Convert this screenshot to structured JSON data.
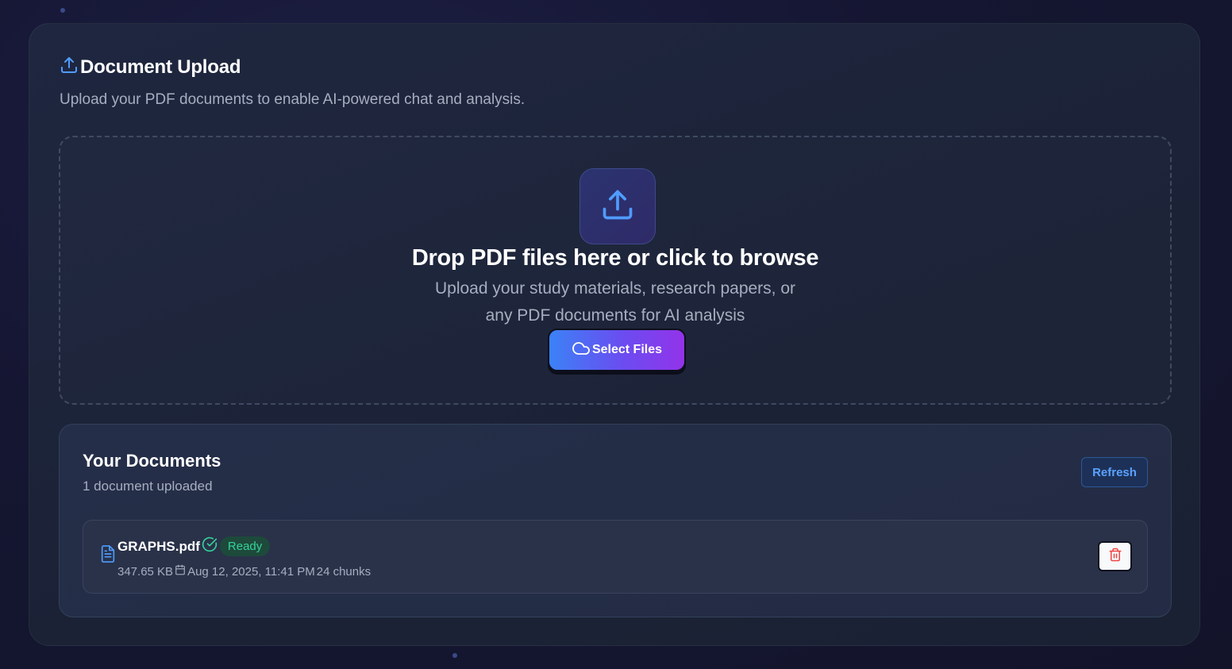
{
  "header": {
    "title": "Document Upload",
    "subtitle": "Upload your PDF documents to enable AI-powered chat and analysis."
  },
  "dropzone": {
    "title": "Drop PDF files here or click to browse",
    "subtitle_line1": "Upload your study materials, research papers, or",
    "subtitle_line2": "any PDF documents for AI analysis",
    "button_label": "Select Files"
  },
  "documents": {
    "title": "Your Documents",
    "count_text": "1 document uploaded",
    "refresh_label": "Refresh",
    "items": [
      {
        "name": "GRAPHS.pdf",
        "status": "Ready",
        "size": "347.65 KB",
        "date": "Aug 12, 2025, 11:41 PM",
        "chunks": "24 chunks"
      }
    ]
  },
  "colors": {
    "accent_blue": "#3b82f6",
    "accent_purple": "#9333ea",
    "ready_green": "#34d399",
    "delete_red": "#ef4444"
  },
  "icons": {
    "header": "upload-icon",
    "dropzone": "upload-icon",
    "select_button": "cloud-icon",
    "document": "file-text-icon",
    "status": "check-circle-icon",
    "date": "calendar-icon",
    "delete": "trash-icon"
  }
}
